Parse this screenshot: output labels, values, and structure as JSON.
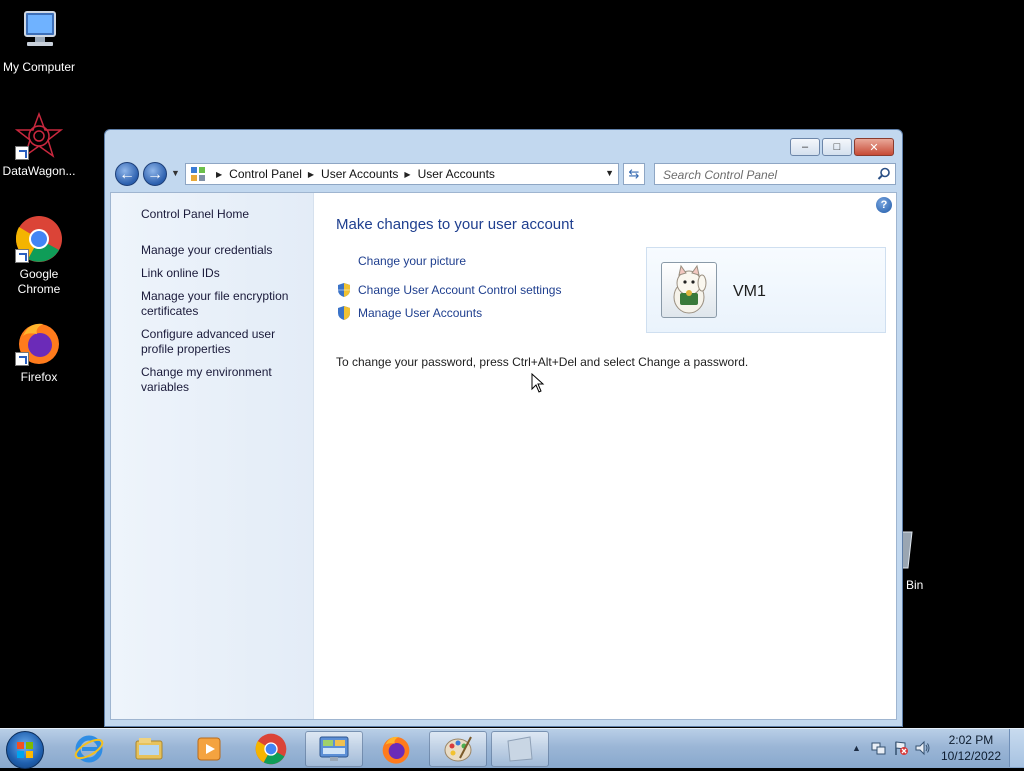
{
  "desktop": {
    "icons": [
      {
        "label": "My Computer"
      },
      {
        "label": "DataWagon..."
      },
      {
        "label": "Google Chrome"
      },
      {
        "label": "Firefox"
      },
      {
        "label": "e Bin"
      }
    ]
  },
  "window": {
    "controls": {
      "minimize": "–",
      "maximize": "□",
      "close": "✕"
    },
    "breadcrumb": [
      "Control Panel",
      "User Accounts",
      "User Accounts"
    ],
    "search_placeholder": "Search Control Panel",
    "sidebar": {
      "home": "Control Panel Home",
      "links": [
        "Manage your credentials",
        "Link online IDs",
        "Manage your file encryption certificates",
        "Configure advanced user profile properties",
        "Change my environment variables"
      ]
    },
    "main": {
      "title": "Make changes to your user account",
      "tasks": [
        "Change your picture",
        "Change User Account Control settings",
        "Manage User Accounts"
      ],
      "user_name": "VM1",
      "password_note": "To change your password, press Ctrl+Alt+Del and select Change a password."
    }
  },
  "taskbar": {
    "time": "2:02 PM",
    "date": "10/12/2022",
    "pinned": [
      "internet-explorer",
      "file-explorer",
      "media-player",
      "chrome",
      "control-panel",
      "firefox",
      "paint",
      "blank-app"
    ]
  }
}
